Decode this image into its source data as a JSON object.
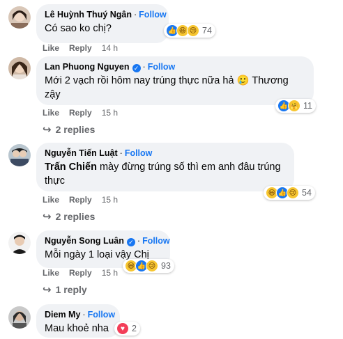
{
  "comments": [
    {
      "name": "Lê Huỳnh Thuý Ngân",
      "verified": false,
      "follow": "Follow",
      "text": "Có sao ko chị?",
      "like": "Like",
      "reply": "Reply",
      "time": "14 h",
      "reaction_count": "74",
      "reaction_icons": [
        "like-icon",
        "haha-icon",
        "sad-icon"
      ]
    },
    {
      "name": "Lan Phuong Nguyen",
      "verified": true,
      "follow": "Follow",
      "text_line1": "Mới 2 vạch rồi hôm nay trúng thực nữa hả 🥲 Thương",
      "text_line2": "zậy",
      "like": "Like",
      "reply": "Reply",
      "time": "15 h",
      "reaction_count": "11",
      "reaction_icons": [
        "like-icon",
        "care-icon"
      ],
      "replies": "2 replies"
    },
    {
      "name": "Nguyễn Tiến Luật",
      "verified": false,
      "follow": "Follow",
      "mention": "Trấn Chiến",
      "text_line1": " mày đừng trúng số thì em anh đâu trúng",
      "text_line2": "thực",
      "like": "Like",
      "reply": "Reply",
      "time": "15 h",
      "reaction_count": "54",
      "reaction_icons": [
        "haha-icon",
        "like-icon",
        "sad-icon"
      ],
      "replies": "2 replies"
    },
    {
      "name": "Nguyễn Song Luân",
      "verified": true,
      "follow": "Follow",
      "text": "Mỗi ngày 1 loại vậy Chị",
      "like": "Like",
      "reply": "Reply",
      "time": "15 h",
      "reaction_count": "93",
      "reaction_icons": [
        "haha-icon",
        "like-icon",
        "sad-icon"
      ],
      "replies": "1 reply"
    },
    {
      "name": "Diem My",
      "verified": false,
      "follow": "Follow",
      "text": "Mau khoẻ nha",
      "reaction_count": "2",
      "reaction_icons": [
        "love-icon"
      ]
    }
  ],
  "colors": {
    "accent": "#1877f2",
    "bubble": "#f0f2f5",
    "meta": "#65676b"
  }
}
